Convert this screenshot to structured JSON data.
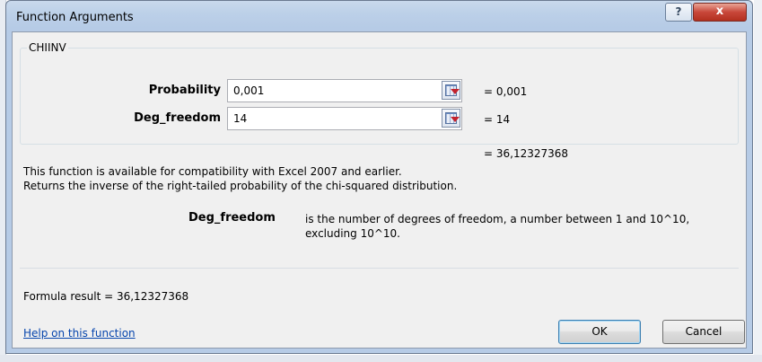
{
  "window": {
    "title": "Function Arguments",
    "help_icon": "?",
    "close_icon": "x"
  },
  "function": {
    "name": "CHIINV",
    "args": [
      {
        "label": "Probability",
        "value": "0,001",
        "result": "=  0,001"
      },
      {
        "label": "Deg_freedom",
        "value": "14",
        "result": "=  14"
      }
    ],
    "result_line": "=  36,12327368"
  },
  "description": {
    "line1": "This function is available for compatibility with Excel 2007 and earlier.",
    "line2": "Returns the inverse of the right-tailed probability of the chi-squared distribution."
  },
  "param_help": {
    "name": "Deg_freedom",
    "text_line1": "is the number of degrees of freedom, a number between 1 and 10^10,",
    "text_line2": "excluding 10^10."
  },
  "formula_result": "Formula result =   36,12327368",
  "help_link": "Help on this function",
  "buttons": {
    "ok": "OK",
    "cancel": "Cancel"
  },
  "icons": {
    "ref_button": "collapse-dialog-icon"
  },
  "colors": {
    "title_bar": "#b6cbe6",
    "close_button": "#c8473a",
    "link": "#0645ad"
  }
}
